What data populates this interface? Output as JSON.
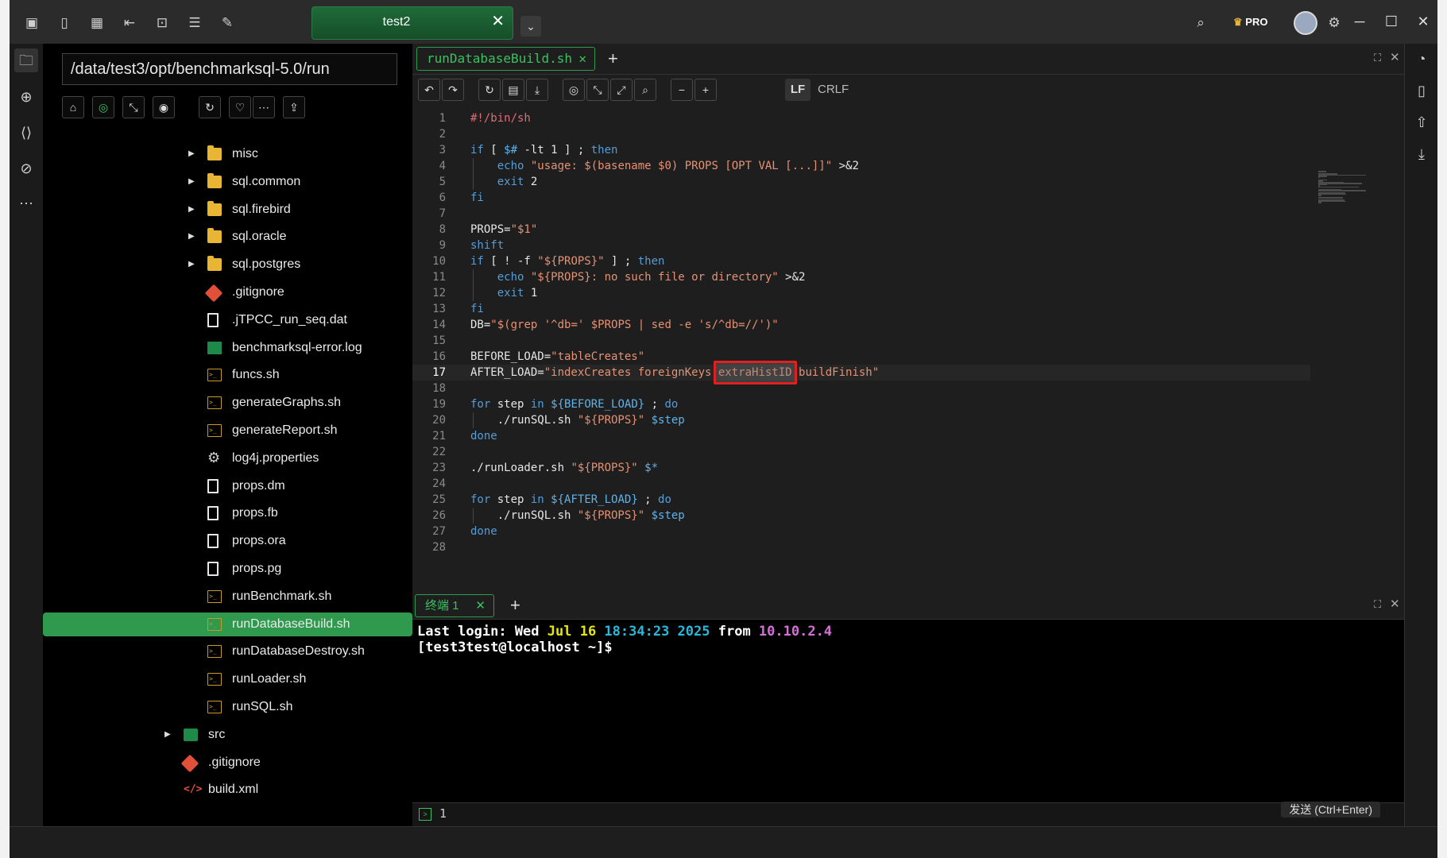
{
  "window": {
    "session_tab": "test2",
    "pro_badge": "PRO"
  },
  "file_panel": {
    "path": "/data/test3/opt/benchmarksql-5.0/run",
    "tree": [
      {
        "name": "misc",
        "type": "folder",
        "expandable": true,
        "depth": 2
      },
      {
        "name": "sql.common",
        "type": "folder",
        "expandable": true,
        "depth": 2
      },
      {
        "name": "sql.firebird",
        "type": "folder",
        "expandable": true,
        "depth": 2
      },
      {
        "name": "sql.oracle",
        "type": "folder",
        "expandable": true,
        "depth": 2
      },
      {
        "name": "sql.postgres",
        "type": "folder",
        "expandable": true,
        "depth": 2
      },
      {
        "name": ".gitignore",
        "type": "git",
        "depth": 2
      },
      {
        "name": ".jTPCC_run_seq.dat",
        "type": "file",
        "depth": 2
      },
      {
        "name": "benchmarksql-error.log",
        "type": "log",
        "depth": 2
      },
      {
        "name": "funcs.sh",
        "type": "sh",
        "depth": 2
      },
      {
        "name": "generateGraphs.sh",
        "type": "sh",
        "depth": 2
      },
      {
        "name": "generateReport.sh",
        "type": "sh",
        "depth": 2
      },
      {
        "name": "log4j.properties",
        "type": "gear",
        "depth": 2
      },
      {
        "name": "props.dm",
        "type": "file",
        "depth": 2
      },
      {
        "name": "props.fb",
        "type": "file",
        "depth": 2
      },
      {
        "name": "props.ora",
        "type": "file",
        "depth": 2
      },
      {
        "name": "props.pg",
        "type": "file",
        "depth": 2
      },
      {
        "name": "runBenchmark.sh",
        "type": "sh",
        "depth": 2
      },
      {
        "name": "runDatabaseBuild.sh",
        "type": "sh",
        "depth": 2,
        "selected": true
      },
      {
        "name": "runDatabaseDestroy.sh",
        "type": "sh",
        "depth": 2
      },
      {
        "name": "runLoader.sh",
        "type": "sh",
        "depth": 2
      },
      {
        "name": "runSQL.sh",
        "type": "sh",
        "depth": 2
      },
      {
        "name": "src",
        "type": "src",
        "expandable": true,
        "depth": 1
      },
      {
        "name": ".gitignore",
        "type": "git",
        "depth": 1
      },
      {
        "name": "build.xml",
        "type": "xml",
        "depth": 1
      }
    ]
  },
  "editor": {
    "file_tab": "runDatabaseBuild.sh",
    "eol_lf": "LF",
    "eol_crlf": "CRLF",
    "current_line": 17,
    "highlighted_word": "extraHistID",
    "lines": [
      "#!/bin/sh",
      "",
      "if [ $# -lt 1 ] ; then",
      "    echo \"usage: $(basename $0) PROPS [OPT VAL [...]]\" >&2",
      "    exit 2",
      "fi",
      "",
      "PROPS=\"$1\"",
      "shift",
      "if [ ! -f \"${PROPS}\" ] ; then",
      "    echo \"${PROPS}: no such file or directory\" >&2",
      "    exit 1",
      "fi",
      "DB=\"$(grep '^db=' $PROPS | sed -e 's/^db=//')\"",
      "",
      "BEFORE_LOAD=\"tableCreates\"",
      "AFTER_LOAD=\"indexCreates foreignKeys extraHistID buildFinish\"",
      "",
      "for step in ${BEFORE_LOAD} ; do",
      "    ./runSQL.sh \"${PROPS}\" $step",
      "done",
      "",
      "./runLoader.sh \"${PROPS}\" $*",
      "",
      "for step in ${AFTER_LOAD} ; do",
      "    ./runSQL.sh \"${PROPS}\" $step",
      "done",
      ""
    ]
  },
  "terminal": {
    "tab": "终端 1",
    "login_prefix": "Last login: Wed ",
    "login_date": "Jul 16 ",
    "login_time": "18:34:23 ",
    "login_year": "2025 ",
    "login_from": "from ",
    "login_ip": "10.10.2.4",
    "prompt": "[test3test@localhost ~]$",
    "input_line_number": "1",
    "send_label": "发送 (Ctrl+Enter)"
  }
}
